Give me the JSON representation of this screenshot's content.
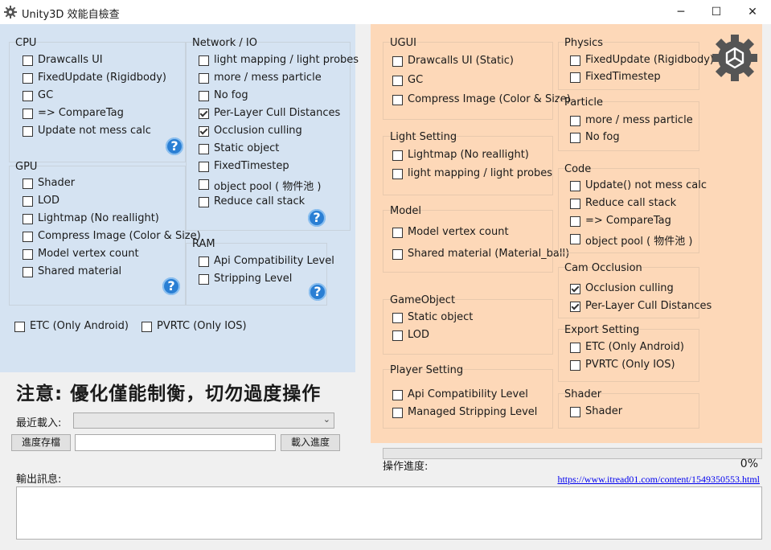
{
  "window": {
    "title": "Unity3D 效能自檢查",
    "minimize": "─",
    "maximize": "☐",
    "close": "✕"
  },
  "left": {
    "cpu": {
      "title": "CPU",
      "items": [
        {
          "label": "Drawcalls UI",
          "checked": false
        },
        {
          "label": "FixedUpdate (Rigidbody)",
          "checked": false
        },
        {
          "label": "GC",
          "checked": false
        },
        {
          "label": "=> CompareTag",
          "checked": false
        },
        {
          "label": "Update not mess calc",
          "checked": false
        }
      ]
    },
    "network": {
      "title": "Network / IO",
      "items": [
        {
          "label": "light mapping / light probes",
          "checked": false
        },
        {
          "label": "more / mess particle",
          "checked": false
        },
        {
          "label": "No fog",
          "checked": false
        },
        {
          "label": "Per-Layer Cull Distances",
          "checked": true
        },
        {
          "label": "Occlusion culling",
          "checked": true
        },
        {
          "label": "Static object",
          "checked": false
        },
        {
          "label": "FixedTimestep",
          "checked": false
        },
        {
          "label": "object pool ( 物件池 )",
          "checked": false
        },
        {
          "label": "Reduce call stack",
          "checked": false
        }
      ]
    },
    "gpu": {
      "title": "GPU",
      "items": [
        {
          "label": "Shader",
          "checked": false
        },
        {
          "label": "LOD",
          "checked": false
        },
        {
          "label": "Lightmap (No reallight)",
          "checked": false
        },
        {
          "label": "Compress Image (Color & Size)",
          "checked": false
        },
        {
          "label": "Model vertex count",
          "checked": false
        },
        {
          "label": "Shared material",
          "checked": false
        }
      ]
    },
    "ram": {
      "title": "RAM",
      "items": [
        {
          "label": "Api Compatibility Level",
          "checked": false
        },
        {
          "label": "Stripping Level",
          "checked": false
        }
      ]
    },
    "etc": {
      "label": "ETC (Only Android)",
      "checked": false
    },
    "pvrtc": {
      "label": "PVRTC (Only IOS)",
      "checked": false
    },
    "help_glyph": "?"
  },
  "right": {
    "ugui": {
      "title": "UGUI",
      "items": [
        {
          "label": "Drawcalls UI (Static)",
          "checked": false
        },
        {
          "label": "GC",
          "checked": false
        },
        {
          "label": "Compress Image (Color & Size)",
          "checked": false
        }
      ]
    },
    "light": {
      "title": "Light Setting",
      "items": [
        {
          "label": "Lightmap (No reallight)",
          "checked": false
        },
        {
          "label": "light mapping / light probes",
          "checked": false
        }
      ]
    },
    "model": {
      "title": "Model",
      "items": [
        {
          "label": "Model vertex count",
          "checked": false
        },
        {
          "label": "Shared material (Material_ball)",
          "checked": false
        }
      ]
    },
    "gameobject": {
      "title": "GameObject",
      "items": [
        {
          "label": "Static object",
          "checked": false
        },
        {
          "label": "LOD",
          "checked": false
        }
      ]
    },
    "player": {
      "title": "Player Setting",
      "items": [
        {
          "label": "Api Compatibility Level",
          "checked": false
        },
        {
          "label": "Managed Stripping Level",
          "checked": false
        }
      ]
    },
    "physics": {
      "title": "Physics",
      "items": [
        {
          "label": "FixedUpdate (Rigidbody)",
          "checked": false
        },
        {
          "label": "FixedTimestep",
          "checked": false
        }
      ]
    },
    "particle": {
      "title": "Particle",
      "items": [
        {
          "label": "more / mess particle",
          "checked": false
        },
        {
          "label": "No fog",
          "checked": false
        }
      ]
    },
    "code": {
      "title": "Code",
      "items": [
        {
          "label": "Update() not mess calc",
          "checked": false
        },
        {
          "label": "Reduce call stack",
          "checked": false
        },
        {
          "label": "=> CompareTag",
          "checked": false
        },
        {
          "label": "object pool ( 物件池 )",
          "checked": false
        }
      ]
    },
    "cam": {
      "title": "Cam Occlusion",
      "items": [
        {
          "label": "Occlusion culling",
          "checked": true
        },
        {
          "label": "Per-Layer Cull Distances",
          "checked": true
        }
      ]
    },
    "export": {
      "title": "Export Setting",
      "items": [
        {
          "label": "ETC (Only Android)",
          "checked": false
        },
        {
          "label": "PVRTC (Only IOS)",
          "checked": false
        }
      ]
    },
    "shader": {
      "title": "Shader",
      "items": [
        {
          "label": "Shader",
          "checked": false
        }
      ]
    }
  },
  "bottom": {
    "notice": "注意: 優化僅能制衡，切勿過度操作",
    "recent_label": "最近載入:",
    "recent_value": "",
    "save_button": "進度存檔",
    "save_name": "",
    "load_button": "載入進度",
    "progress_label": "操作進度:",
    "progress_value": "0%",
    "progress_fraction": 0,
    "output_label": "輸出訊息:",
    "link": "https://www.itread01.com/content/1549350553.html",
    "output_text": ""
  }
}
